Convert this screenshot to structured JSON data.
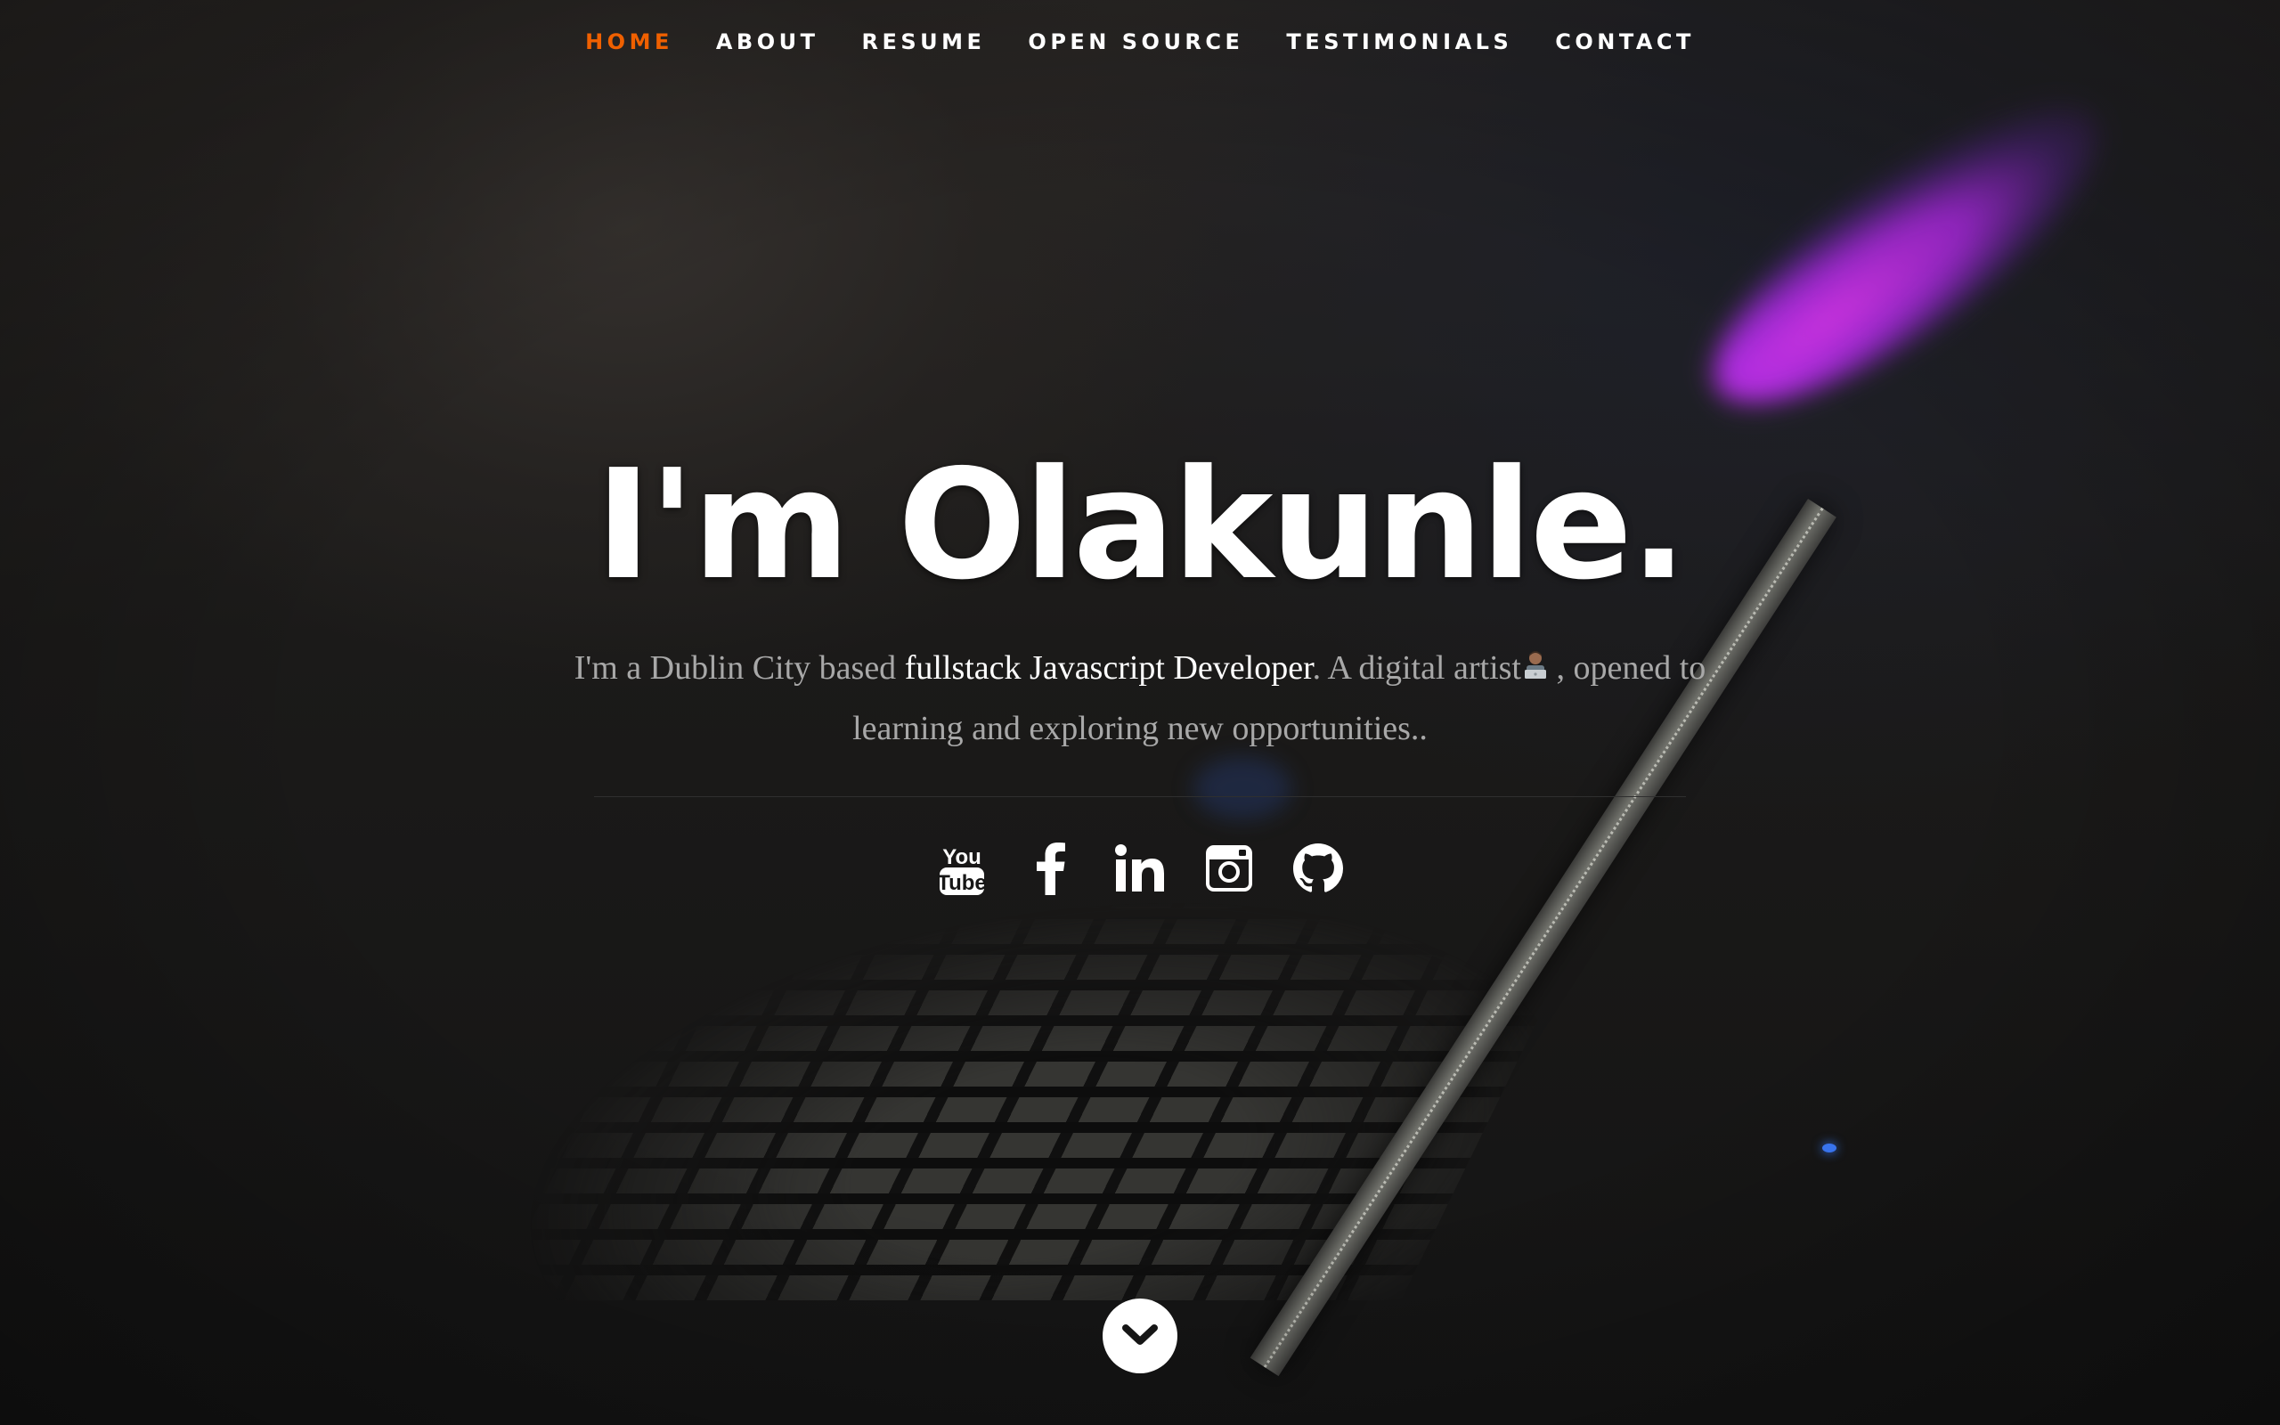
{
  "nav": {
    "items": [
      {
        "label": "HOME",
        "active": true
      },
      {
        "label": "ABOUT"
      },
      {
        "label": "RESUME"
      },
      {
        "label": "OPEN SOURCE"
      },
      {
        "label": "TESTIMONIALS"
      },
      {
        "label": "CONTACT"
      }
    ],
    "active_color": "#f06000",
    "text_color": "#ffffff"
  },
  "banner": {
    "headline": "I'm Olakunle.",
    "intro_prefix": "I'm a Dublin City based ",
    "intro_highlight": "fullstack Javascript Developer",
    "intro_middle": ". A digital artist",
    "intro_suffix": " , opened to learning and exploring new opportunities..",
    "emoji_icon": "technologist-emoji-icon"
  },
  "social": [
    {
      "name": "youtube",
      "icon": "youtube-icon"
    },
    {
      "name": "facebook",
      "icon": "facebook-icon"
    },
    {
      "name": "linkedin",
      "icon": "linkedin-icon"
    },
    {
      "name": "instagram",
      "icon": "instagram-icon"
    },
    {
      "name": "github",
      "icon": "github-icon"
    }
  ],
  "scroll_down": {
    "icon": "chevron-down-icon"
  }
}
